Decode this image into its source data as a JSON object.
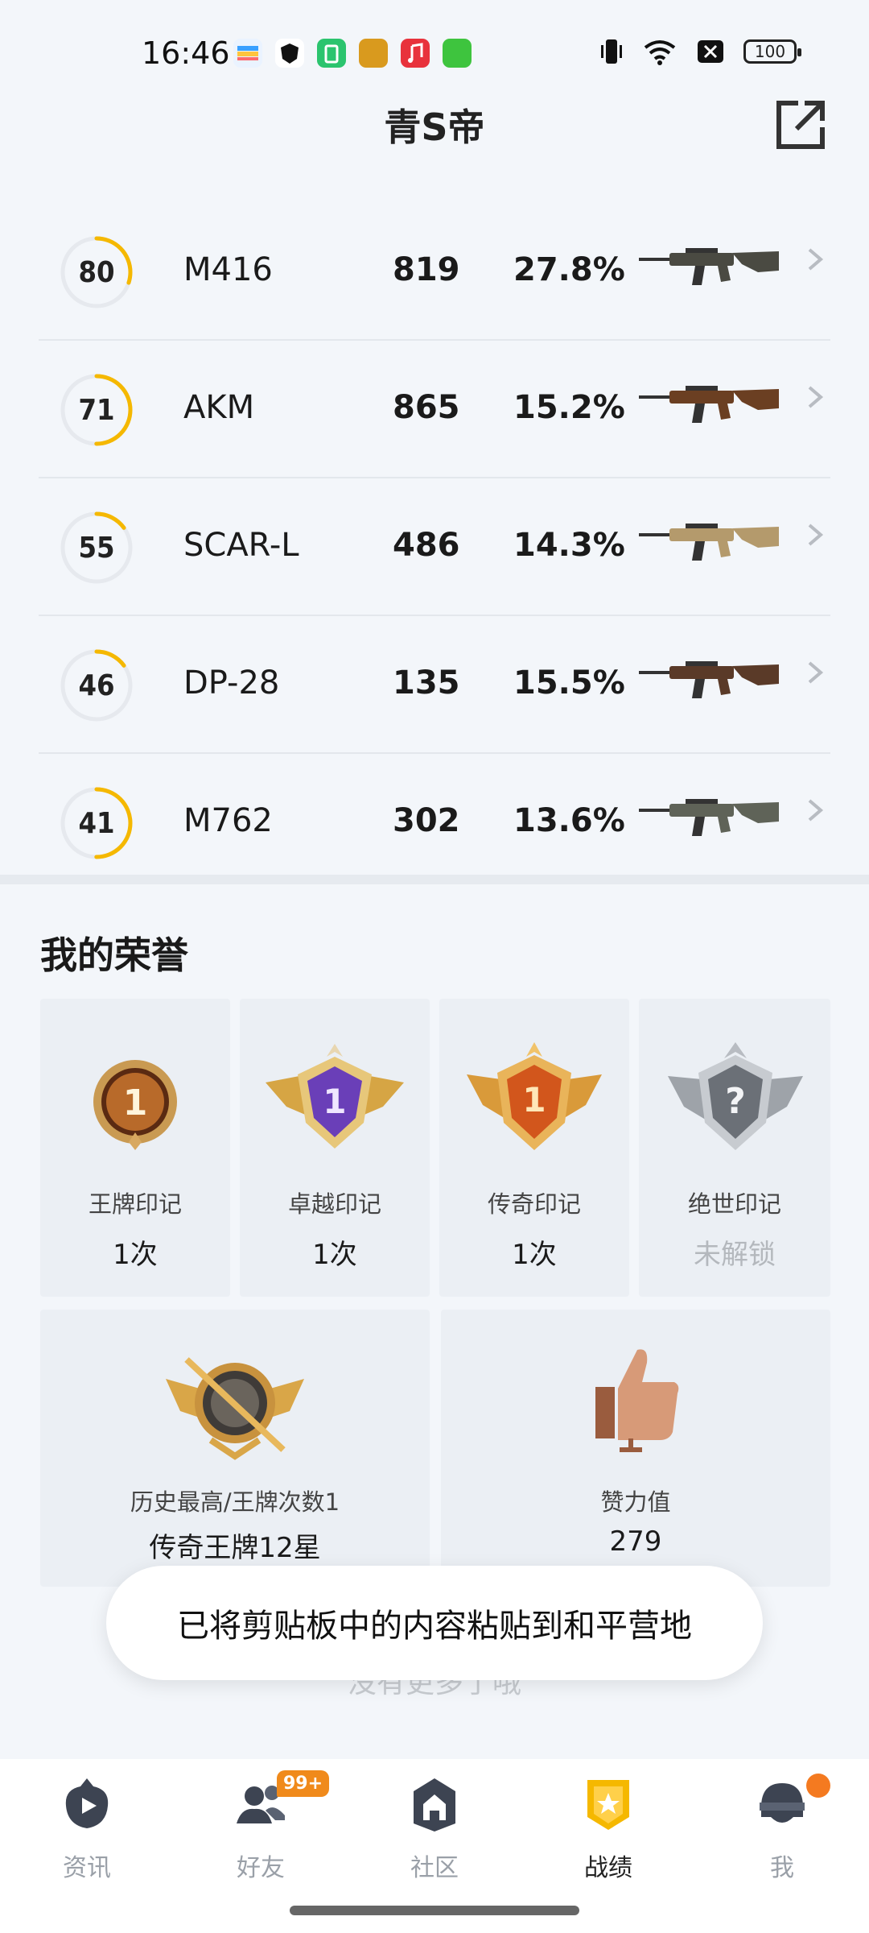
{
  "status_bar": {
    "time": "16:46",
    "battery": "100"
  },
  "header": {
    "title": "青S帝"
  },
  "weapons": [
    {
      "score": "80",
      "progress": 0.3,
      "name": "M416",
      "count": "819",
      "rate": "27.8%",
      "gun_color": "#4a4a42"
    },
    {
      "score": "71",
      "progress": 0.5,
      "name": "AKM",
      "count": "865",
      "rate": "15.2%",
      "gun_color": "#6b3f22"
    },
    {
      "score": "55",
      "progress": 0.15,
      "name": "SCAR-L",
      "count": "486",
      "rate": "14.3%",
      "gun_color": "#b49a6c"
    },
    {
      "score": "46",
      "progress": 0.15,
      "name": "DP-28",
      "count": "135",
      "rate": "15.5%",
      "gun_color": "#5a3a28"
    },
    {
      "score": "41",
      "progress": 0.5,
      "name": "M762",
      "count": "302",
      "rate": "13.6%",
      "gun_color": "#5f6358"
    }
  ],
  "honors": {
    "title": "我的荣誉",
    "marks": [
      {
        "label": "王牌印记",
        "value": "1次",
        "locked": false,
        "icon": "ace-mark-icon"
      },
      {
        "label": "卓越印记",
        "value": "1次",
        "locked": false,
        "icon": "excellence-mark-icon"
      },
      {
        "label": "传奇印记",
        "value": "1次",
        "locked": false,
        "icon": "legend-mark-icon"
      },
      {
        "label": "绝世印记",
        "value": "未解锁",
        "locked": true,
        "icon": "peerless-mark-icon"
      }
    ],
    "stats": [
      {
        "label": "历史最高/王牌次数1",
        "value": "传奇王牌12星",
        "icon": "rank-emblem-icon"
      },
      {
        "label": "赞力值",
        "value": "279",
        "icon": "thumbs-up-icon"
      }
    ]
  },
  "no_more": "没有更多了哦",
  "toast": "已将剪贴板中的内容粘贴到和平营地",
  "nav": [
    {
      "label": "资讯",
      "icon": "news-icon",
      "active": false
    },
    {
      "label": "好友",
      "icon": "friends-icon",
      "active": false,
      "badge": "99+"
    },
    {
      "label": "社区",
      "icon": "community-icon",
      "active": false
    },
    {
      "label": "战绩",
      "icon": "record-icon",
      "active": true
    },
    {
      "label": "我",
      "icon": "profile-icon",
      "active": false,
      "dot": true
    }
  ],
  "colors": {
    "accent": "#f5b800",
    "badge": "#f08a1b"
  }
}
